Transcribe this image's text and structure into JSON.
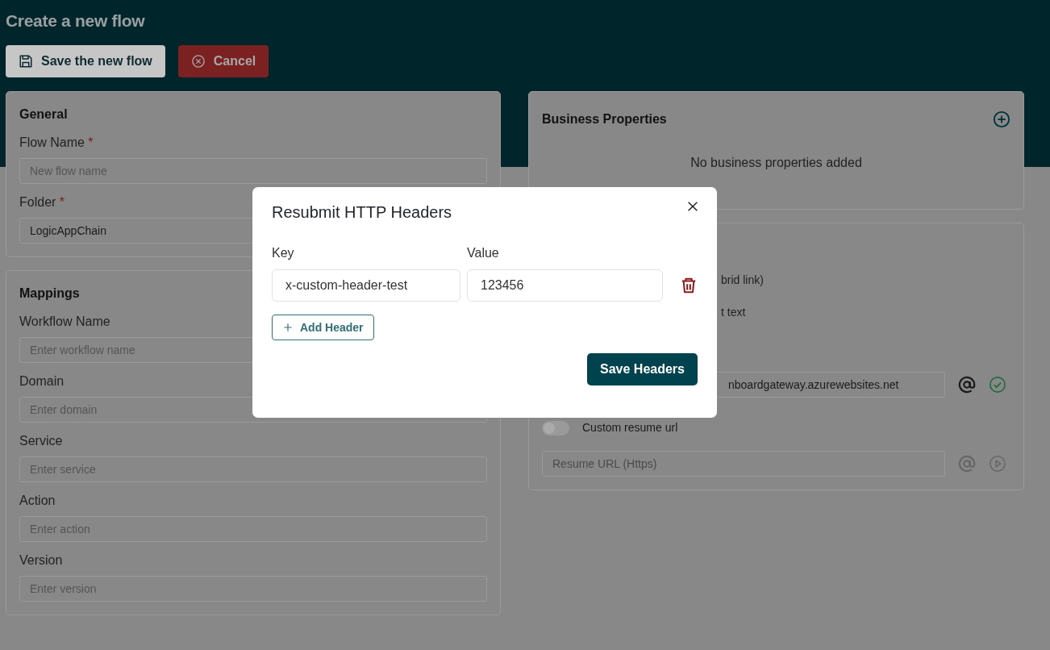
{
  "page": {
    "title": "Create a new flow"
  },
  "toolbar": [
    {
      "label": "Save the new flow",
      "kind": "save"
    },
    {
      "label": "Cancel",
      "kind": "cancel"
    }
  ],
  "general": {
    "title": "General",
    "fields": [
      {
        "label": "Flow Name",
        "marker": "*",
        "placeholder": "New flow name"
      },
      {
        "label": "Folder",
        "marker": "*",
        "value": "LogicAppChain"
      }
    ]
  },
  "mappings": {
    "title": "Mappings",
    "fields": [
      {
        "label": "Workflow Name",
        "placeholder": "Enter workflow name"
      },
      {
        "label": "Domain",
        "placeholder": "Enter domain"
      },
      {
        "label": "Service",
        "placeholder": "Enter service"
      },
      {
        "label": "Action",
        "placeholder": "Enter action"
      },
      {
        "label": "Version",
        "placeholder": "Enter version"
      }
    ]
  },
  "business_properties": {
    "title": "Business Properties",
    "empty_text": "No business properties added"
  },
  "resubmit": {
    "options": [
      "brid link)",
      "t text"
    ],
    "url_value": "nboardgateway.azurewebsites.net",
    "custom_resume": {
      "label": "Custom resume url",
      "on": false
    },
    "resume_url": {
      "placeholder": "Resume URL (Https)"
    }
  },
  "modal": {
    "title": "Resubmit HTTP Headers",
    "key_label": "Key",
    "value_label": "Value",
    "headers": [
      {
        "key": "x-custom-header-test",
        "value": "123456"
      }
    ],
    "add_button": "Add Header",
    "save_button": "Save Headers"
  }
}
